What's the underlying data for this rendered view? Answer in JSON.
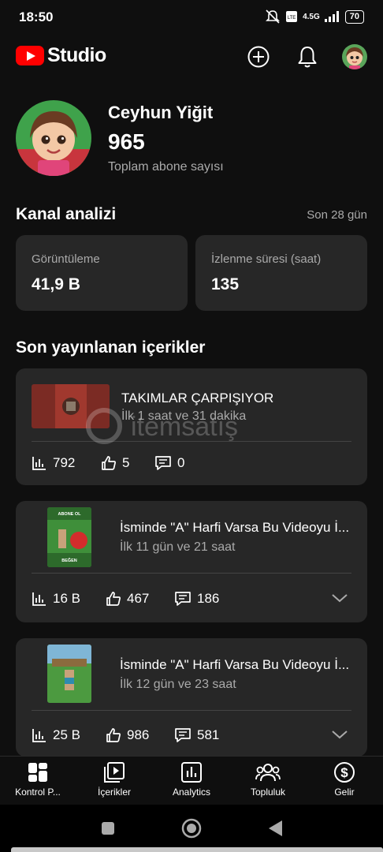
{
  "status": {
    "time": "18:50",
    "network": "4.5G",
    "battery": "70"
  },
  "header": {
    "logo_text": "Studio",
    "icons": [
      "create-icon",
      "bell-icon"
    ]
  },
  "channel": {
    "name": "Ceyhun Yiğit",
    "subscribers": "965",
    "subscribers_label": "Toplam abone sayısı"
  },
  "analytics": {
    "title": "Kanal analizi",
    "period": "Son 28 gün",
    "views_label": "Görüntüleme",
    "views_value": "41,9 B",
    "watch_label": "İzlenme süresi (saat)",
    "watch_value": "135"
  },
  "recent": {
    "title": "Son yayınlanan içerikler",
    "items": [
      {
        "title": "TAKIMLAR ÇARPIŞIYOR",
        "time": "İlk 1 saat ve 31 dakika",
        "views": "792",
        "likes": "5",
        "comments": "0"
      },
      {
        "title": "İsminde \"A\" Harfi Varsa Bu Videoyu İ...",
        "time": "İlk 11 gün ve 21 saat",
        "views": "16 B",
        "likes": "467",
        "comments": "186",
        "thumb_top": "ABONE OL",
        "thumb_bottom": "BEĞEN"
      },
      {
        "title": "İsminde \"A\" Harfi Varsa Bu Videoyu İ...",
        "time": "İlk 12 gün ve 23 saat",
        "views": "25 B",
        "likes": "986",
        "comments": "581"
      }
    ]
  },
  "nav": {
    "items": [
      {
        "label": "Kontrol P...",
        "icon": "dashboard-icon"
      },
      {
        "label": "İçerikler",
        "icon": "content-icon"
      },
      {
        "label": "Analytics",
        "icon": "analytics-icon"
      },
      {
        "label": "Topluluk",
        "icon": "community-icon"
      },
      {
        "label": "Gelir",
        "icon": "earn-icon"
      }
    ]
  },
  "watermark": "itemsatış",
  "colors": {
    "background": "#0f0f0f",
    "card": "#272727",
    "brand_red": "#ff0000",
    "secondary_text": "#aaaaaa"
  }
}
